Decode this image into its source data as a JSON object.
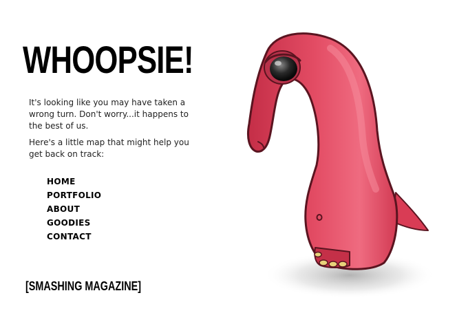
{
  "page": {
    "title": "WHOOPSIE!",
    "paragraphs": [
      "It's looking like you may have taken a wrong turn. Don't worry...it happens to the best of us.",
      "Here's a little map that might help you get back on track:"
    ]
  },
  "nav": {
    "items": [
      {
        "label": "HOME"
      },
      {
        "label": "PORTFOLIO"
      },
      {
        "label": "ABOUT"
      },
      {
        "label": "GOODIES"
      },
      {
        "label": "CONTACT"
      }
    ]
  },
  "footer": {
    "brand": "[SMASHING MAGAZINE]"
  },
  "illustration": {
    "icon": "pink-dinosaur-illustration",
    "body_color": "#e0475f",
    "outline_color": "#5a1420"
  }
}
